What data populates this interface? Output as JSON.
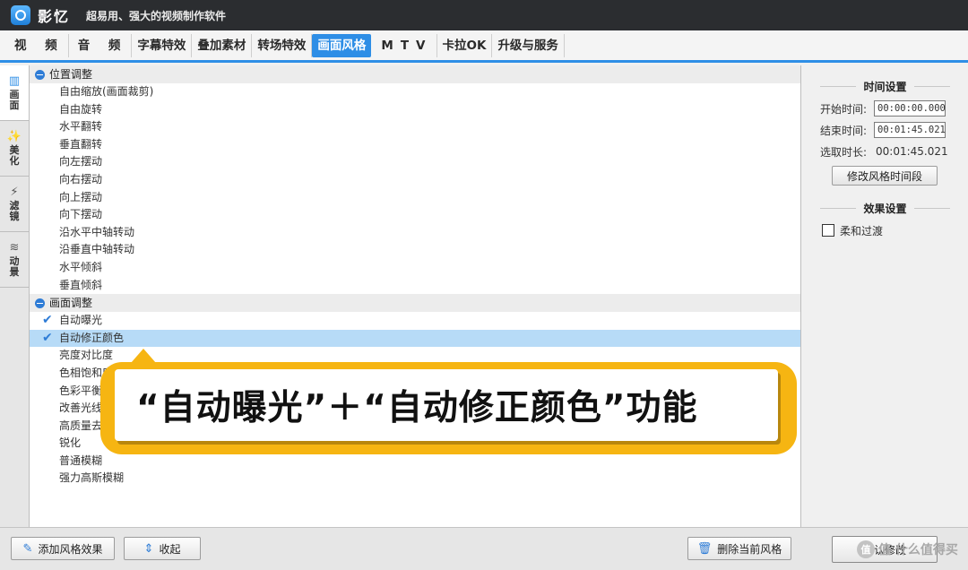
{
  "titlebar": {
    "app_name": "影忆",
    "slogan": "超易用、强大的视频制作软件"
  },
  "menu": [
    {
      "label": "视 频",
      "spaced": true
    },
    {
      "label": "音 频",
      "spaced": true
    },
    {
      "label": "字幕特效"
    },
    {
      "label": "叠加素材"
    },
    {
      "label": "转场特效"
    },
    {
      "label": "画面风格",
      "active": true
    },
    {
      "label": "MTV",
      "spaced": true
    },
    {
      "label": "卡拉OK"
    },
    {
      "label": "升级与服务"
    }
  ],
  "sidetabs": [
    {
      "label": "画面",
      "icon": "film-icon",
      "active": true
    },
    {
      "label": "美化",
      "icon": "magic-wand-icon"
    },
    {
      "label": "滤镜",
      "icon": "wand-sparkle-icon"
    },
    {
      "label": "动景",
      "icon": "waves-icon"
    }
  ],
  "groups": [
    {
      "title": "位置调整",
      "items": [
        "自由缩放(画面裁剪)",
        "自由旋转",
        "水平翻转",
        "垂直翻转",
        "向左摆动",
        "向右摆动",
        "向上摆动",
        "向下摆动",
        "沿水平中轴转动",
        "沿垂直中轴转动",
        "水平倾斜",
        "垂直倾斜"
      ]
    },
    {
      "title": "画面调整",
      "items": [
        "自动曝光",
        "自动修正颜色",
        "亮度对比度",
        "色相饱和度",
        "色彩平衡",
        "改善光线",
        "高质量去",
        "锐化",
        "普通模糊",
        "强力高斯模糊"
      ]
    }
  ],
  "right_panel": {
    "time_settings_title": "时间设置",
    "start_label": "开始时间:",
    "start_value": "00:00:00.000",
    "end_label": "结束时间:",
    "end_value": "00:01:45.021",
    "length_label": "选取时长:",
    "length_value": "00:01:45.021",
    "modify_button": "修改风格时间段",
    "effect_settings_title": "效果设置",
    "soft_transition_label": "柔和过渡"
  },
  "bottombar": {
    "add_button": "添加风格效果",
    "collapse_button": "收起",
    "delete_button": "删除当前风格",
    "confirm_button": "确认修改"
  },
  "callout": {
    "text": "“自动曝光”＋“自动修正颜色”功能"
  },
  "watermark": {
    "text": "值 什么值得买"
  }
}
